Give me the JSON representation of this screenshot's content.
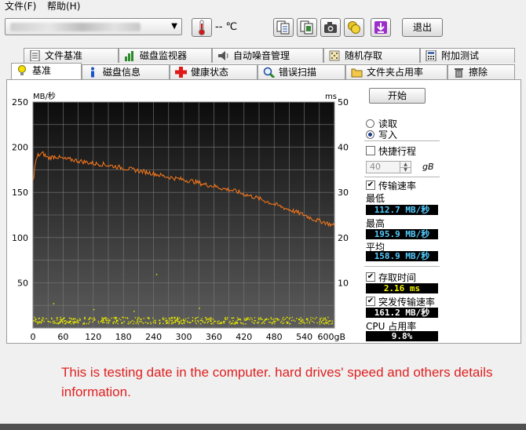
{
  "menu": {
    "file": "文件(F)",
    "help": "帮助(H)"
  },
  "toolbar": {
    "drive": "",
    "temperature": "-- ℃",
    "exit_label": "退出",
    "icons": [
      "thermometer-icon",
      "copy-text-icon",
      "copy-image-icon",
      "camera-icon",
      "coins-icon",
      "download-arrow-icon"
    ]
  },
  "tabs_top": [
    "文件基准",
    "磁盘监视器",
    "自动噪音管理",
    "随机存取",
    "附加测试"
  ],
  "tabs_bottom": [
    "基准",
    "磁盘信息",
    "健康状态",
    "错误扫描",
    "文件夹占用率",
    "擦除"
  ],
  "side": {
    "start_label": "开始",
    "read_label": "读取",
    "write_label": "写入",
    "write_selected": true,
    "short_stroke_label": "快捷行程",
    "short_stroke_checked": false,
    "short_stroke_value": "40",
    "short_stroke_unit": "gB",
    "transfer_rate_label": "传输速率",
    "transfer_rate_checked": true,
    "min_label": "最低",
    "min_value": "112.7 MB/秒",
    "max_label": "最高",
    "max_value": "195.9 MB/秒",
    "avg_label": "平均",
    "avg_value": "158.9 MB/秒",
    "access_time_label": "存取时间",
    "access_time_checked": true,
    "access_time_value": "2.16 ms",
    "burst_label": "突发传输速率",
    "burst_checked": true,
    "burst_value": "161.2 MB/秒",
    "cpu_label": "CPU 占用率",
    "cpu_value": "9.8%"
  },
  "chart_data": {
    "type": "line",
    "ylabel_left": "MB/秒",
    "ylabel_right": "ms",
    "ylim_left": [
      0,
      250
    ],
    "ylim_right": [
      0,
      50
    ],
    "xlim": [
      0,
      600
    ],
    "y_ticks_left": [
      "250",
      "200",
      "150",
      "100",
      "50"
    ],
    "y_ticks_right": [
      "50",
      "40",
      "30",
      "20",
      "10"
    ],
    "x_ticks": [
      "0",
      "60",
      "120",
      "180",
      "240",
      "300",
      "360",
      "420",
      "480",
      "540",
      "600gB"
    ],
    "grid": true,
    "series": [
      {
        "color": "#ff7a1a",
        "axis": "left",
        "x": [
          0,
          5,
          10,
          20,
          30,
          45,
          60,
          80,
          100,
          120,
          140,
          160,
          180,
          200,
          220,
          240,
          260,
          280,
          300,
          320,
          340,
          360,
          380,
          400,
          420,
          440,
          460,
          480,
          500,
          520,
          540,
          560,
          580,
          600
        ],
        "values": [
          162,
          183,
          191,
          193,
          188,
          190,
          187,
          186,
          184,
          182,
          181,
          179,
          177,
          175,
          173,
          171,
          168,
          166,
          164,
          162,
          159,
          157,
          154,
          152,
          148,
          145,
          141,
          137,
          133,
          129,
          125,
          120,
          117,
          113
        ]
      },
      {
        "color": "#e6e600",
        "axis": "right",
        "name_hidden": true,
        "x_range": [
          0,
          600
        ],
        "values_ms": [
          1.0,
          2.5
        ]
      }
    ]
  },
  "caption": "This is testing date in the computer. hard drives' speed and others details information."
}
